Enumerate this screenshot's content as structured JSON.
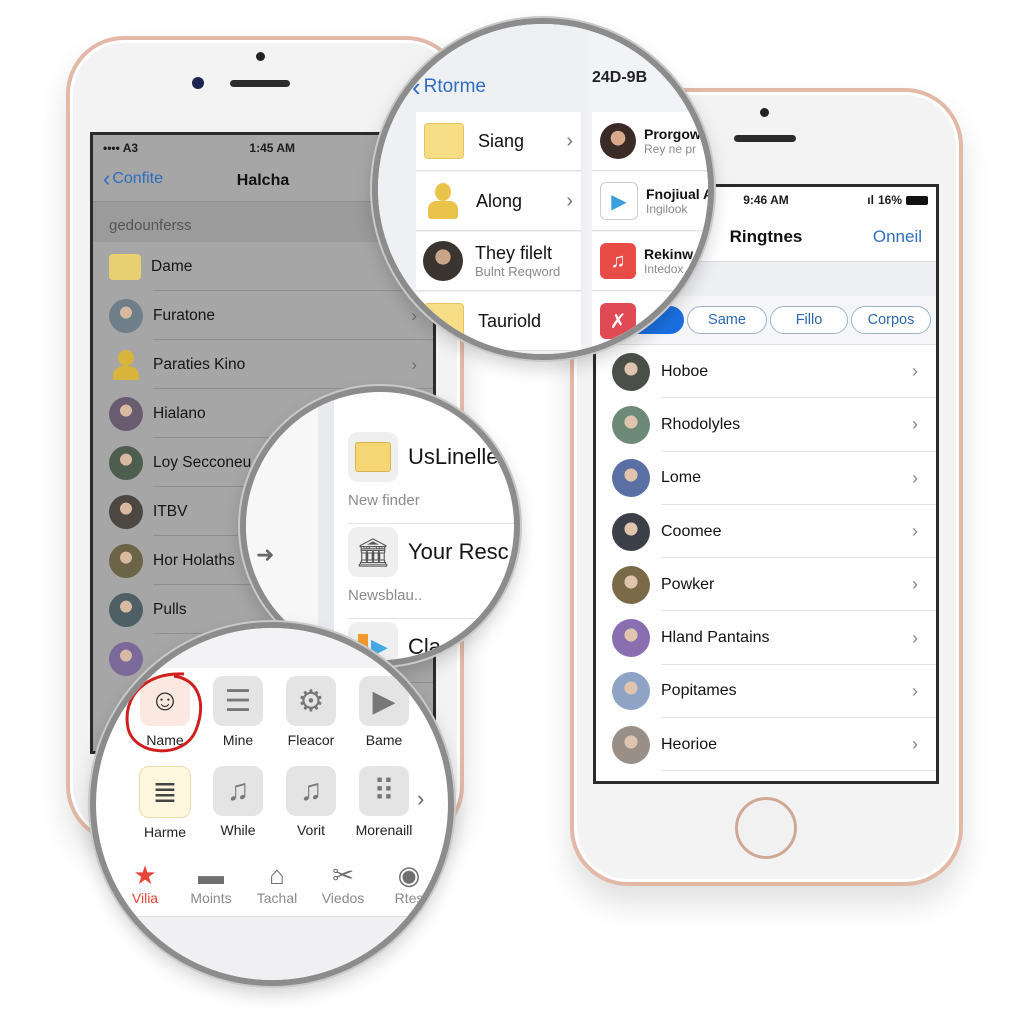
{
  "left_phone": {
    "status": {
      "carrier": "•••• A3",
      "time": "1:45 AM"
    },
    "nav": {
      "back_label": "Confite",
      "title": "Halcha"
    },
    "section_header": "gedounferss",
    "items": [
      {
        "label": "Dame",
        "avatar": "folder-icon",
        "chevron": false,
        "color": "#e8cf72"
      },
      {
        "label": "Furatone",
        "avatar": "photo",
        "chevron": true,
        "color": "#6f7f8a"
      },
      {
        "label": "Paraties Kino",
        "avatar": "person-icon",
        "chevron": true,
        "color": "#d8b43c"
      },
      {
        "label": "Hialano",
        "avatar": "photo",
        "chevron": false,
        "color": "#6a5c70"
      },
      {
        "label": "Loy Secconeu",
        "avatar": "photo",
        "chevron": false,
        "color": "#4d5e4e"
      },
      {
        "label": "ITBV",
        "avatar": "photo",
        "chevron": false,
        "color": "#4c4740"
      },
      {
        "label": "Hor Holaths",
        "avatar": "photo",
        "chevron": false,
        "color": "#6b6447"
      },
      {
        "label": "Pulls",
        "avatar": "photo",
        "chevron": false,
        "color": "#4e5f66"
      },
      {
        "label": "",
        "avatar": "photo",
        "chevron": false,
        "color": "#7b6a99"
      }
    ]
  },
  "right_phone": {
    "status": {
      "time": "9:46 AM",
      "battery": "16%"
    },
    "nav": {
      "title": "Ringtnes",
      "action_label": "Onneil"
    },
    "segments": [
      {
        "label": "",
        "active": true
      },
      {
        "label": "Same",
        "active": false
      },
      {
        "label": "Fillo",
        "active": false
      },
      {
        "label": "Corpos",
        "active": false
      }
    ],
    "items": [
      {
        "label": "Hoboe",
        "color": "#4a4f4a"
      },
      {
        "label": "Rhodolyles",
        "color": "#6d8a78"
      },
      {
        "label": "Lome",
        "color": "#5a6fa3"
      },
      {
        "label": "Coomee",
        "color": "#3b3f48"
      },
      {
        "label": "Powker",
        "color": "#7a6a48"
      },
      {
        "label": "Hland Pantains",
        "color": "#8a6fb0"
      },
      {
        "label": "Popitames",
        "color": "#8fa3c4"
      },
      {
        "label": "Heorioe",
        "color": "#9a8f86"
      }
    ]
  },
  "mag_top": {
    "back_label": "Rtorme",
    "header_right": "24D-9B",
    "left_items": [
      {
        "label": "Siang",
        "sub": "",
        "icon": "folder-icon",
        "chevron": true
      },
      {
        "label": "Along",
        "sub": "",
        "icon": "person-icon",
        "chevron": true
      },
      {
        "label": "They filelt",
        "sub": "Bulnt Reqword",
        "icon": "photo",
        "chevron": false
      },
      {
        "label": "Tauriold",
        "sub": "",
        "icon": "folder-icon",
        "chevron": false
      }
    ],
    "right_items": [
      {
        "label": "Prorgow",
        "sub": "Rey ne pr",
        "icon": "photo"
      },
      {
        "label": "Fnojiual A",
        "sub": "Ingilook",
        "icon": "play-icon"
      },
      {
        "label": "Rekinw",
        "sub": "Intedox",
        "icon": "music-icon"
      },
      {
        "label": "",
        "sub": "",
        "icon": "x-icon"
      }
    ]
  },
  "mag_mid": {
    "items": [
      {
        "title": "UsLinelle",
        "sub": "New finder",
        "icon": "folder-icon"
      },
      {
        "title": "Your Resc",
        "sub": "Newsblau..",
        "icon": "building-icon"
      },
      {
        "title": "Cla",
        "sub": "",
        "icon": "media-icon"
      }
    ]
  },
  "mag_bottom": {
    "grid": [
      {
        "label": "Name",
        "icon": "face-icon",
        "highlighted": true
      },
      {
        "label": "Mine",
        "icon": "list-icon",
        "highlighted": false
      },
      {
        "label": "Fleacor",
        "icon": "gear-icon",
        "highlighted": false
      },
      {
        "label": "Bame",
        "icon": "play-icon",
        "highlighted": false
      },
      {
        "label": "Harme",
        "icon": "notes-icon",
        "highlighted": false
      },
      {
        "label": "While",
        "icon": "music-icon",
        "highlighted": false
      },
      {
        "label": "Vorit",
        "icon": "music-icon",
        "highlighted": false
      },
      {
        "label": "Morenaill",
        "icon": "keypad-icon",
        "highlighted": false
      }
    ],
    "tabs": [
      {
        "label": "Vilia",
        "icon": "star-icon",
        "active": true
      },
      {
        "label": "Moints",
        "icon": "folder-icon",
        "active": false
      },
      {
        "label": "Tachal",
        "icon": "home-icon",
        "active": false
      },
      {
        "label": "Viedos",
        "icon": "tools-icon",
        "active": false
      },
      {
        "label": "Rtes",
        "icon": "record-icon",
        "active": false
      }
    ],
    "accent": "#e8443a"
  }
}
